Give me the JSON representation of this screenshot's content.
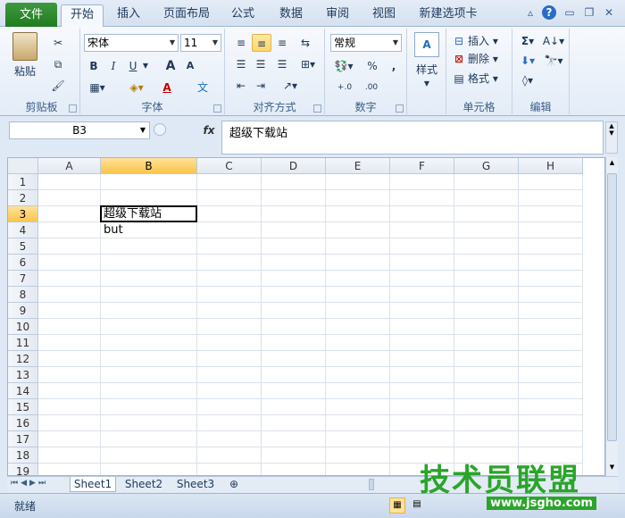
{
  "tabs": {
    "file": "文件",
    "items": [
      "开始",
      "插入",
      "页面布局",
      "公式",
      "数据",
      "审阅",
      "视图",
      "新建选项卡"
    ]
  },
  "ribbon": {
    "clipboard": {
      "label": "剪贴板",
      "paste": "粘贴"
    },
    "font": {
      "label": "字体",
      "name": "宋体",
      "size": "11",
      "bold": "B",
      "italic": "I",
      "underline": "U",
      "grow": "A",
      "shrink": "A",
      "color_a": "A",
      "wen": "文"
    },
    "align": {
      "label": "对齐方式"
    },
    "number": {
      "label": "数字",
      "format": "常规",
      "percent": "%",
      "comma": ",",
      "inc": "+.0",
      "dec": ".00"
    },
    "styles": {
      "label": "样式"
    },
    "cells": {
      "label": "单元格",
      "insert": "插入",
      "delete": "删除",
      "format": "格式"
    },
    "editing": {
      "label": "编辑",
      "sigma": "Σ"
    }
  },
  "formula": {
    "namebox": "B3",
    "fx": "fx",
    "content": "超级下载站"
  },
  "grid": {
    "columns": [
      "A",
      "B",
      "C",
      "D",
      "E",
      "F",
      "G",
      "H"
    ],
    "rows": [
      "1",
      "2",
      "3",
      "4",
      "5",
      "6",
      "7",
      "8",
      "9",
      "10",
      "11",
      "12",
      "13",
      "14",
      "15",
      "16",
      "17",
      "18",
      "19"
    ],
    "cells": {
      "B3": "超级下载站",
      "B4": "but"
    }
  },
  "sheets": [
    "Sheet1",
    "Sheet2",
    "Sheet3"
  ],
  "status": {
    "ready": "就绪"
  },
  "watermark": {
    "text": "技术员联盟",
    "url": "www.jsgho.com"
  }
}
